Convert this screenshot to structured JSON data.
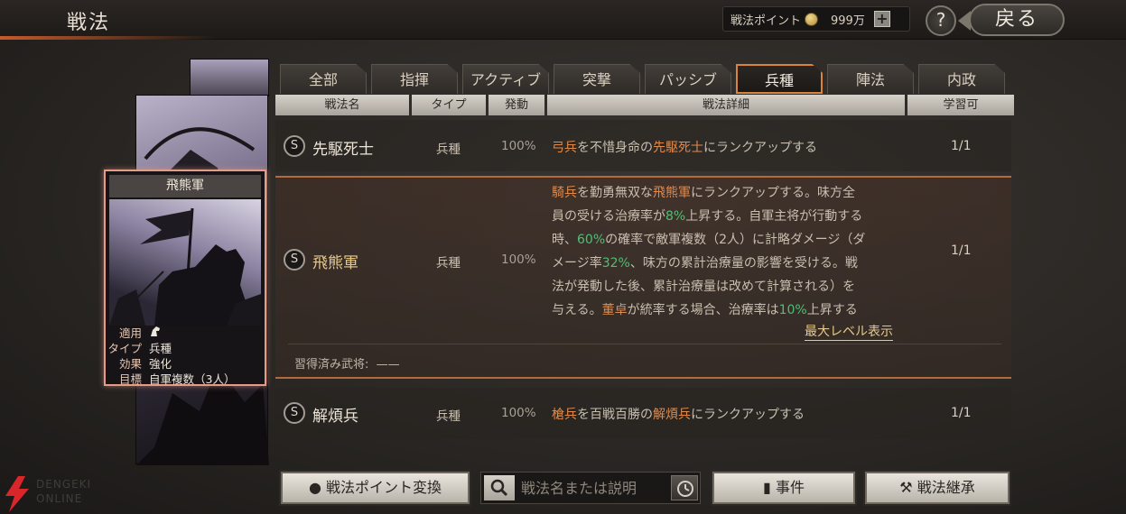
{
  "header": {
    "title": "戦法",
    "points_label": "戦法ポイント",
    "points_value": "999万",
    "plus_label": "+",
    "help_label": "?",
    "back_label": "戻る"
  },
  "tabs": [
    {
      "label": "全部"
    },
    {
      "label": "指揮"
    },
    {
      "label": "アクティブ"
    },
    {
      "label": "突撃"
    },
    {
      "label": "パッシブ"
    },
    {
      "label": "兵種",
      "active": true
    },
    {
      "label": "陣法"
    },
    {
      "label": "内政"
    }
  ],
  "columns": {
    "name": "戦法名",
    "type": "タイプ",
    "trigger": "発動",
    "detail": "戦法詳細",
    "learnable": "学習可"
  },
  "card": {
    "title": "飛熊軍",
    "rows": [
      {
        "key": "適用",
        "value": ""
      },
      {
        "key": "タイプ",
        "value": "兵種"
      },
      {
        "key": "効果",
        "value": "強化"
      },
      {
        "key": "目標",
        "value": "自軍複数（3人）"
      }
    ]
  },
  "rows": [
    {
      "grade": "S",
      "name": "先駆死士",
      "type": "兵種",
      "rate": "100%",
      "detail": [
        "弓兵",
        "を不惜身命の",
        "先駆死士",
        "にランクアップする"
      ],
      "learnable": "1/1"
    },
    {
      "grade": "S",
      "name": "飛熊軍",
      "type": "兵種",
      "rate": "100%",
      "detail_lines": [
        [
          "騎兵",
          "を勤勇無双な",
          "飛熊軍",
          "にランクアップする。味方全"
        ],
        [
          "員の受ける治療率が",
          "8%",
          "上昇する。自軍主将が行動する"
        ],
        [
          "時、",
          "60%",
          "の確率で敵軍複数（2人）に計略ダメージ（ダ"
        ],
        [
          "メージ率",
          "32%",
          "、味方の累計治療量の影響を受ける。戦"
        ],
        [
          "法が発動した後、累計治療量は改めて計算される）を"
        ],
        [
          "与える。",
          "董卓",
          "が統率する場合、治療率は",
          "10%",
          "上昇する"
        ]
      ],
      "max_level_label": "最大レベル表示",
      "learned_label": "習得済み武将:",
      "learned_value": "——",
      "learnable": "1/1"
    },
    {
      "grade": "S",
      "name": "解煩兵",
      "type": "兵種",
      "rate": "100%",
      "detail": [
        "槍兵",
        "を百戦百勝の",
        "解煩兵",
        "にランクアップする"
      ],
      "learnable": "1/1"
    }
  ],
  "bottom": {
    "convert_label": "戦法ポイント変換",
    "search_placeholder": "戦法名または説明",
    "event_label": "事件",
    "inherit_label": "戦法継承"
  },
  "watermark": {
    "line1": "DENGEKI",
    "line2": "ONLINE"
  }
}
